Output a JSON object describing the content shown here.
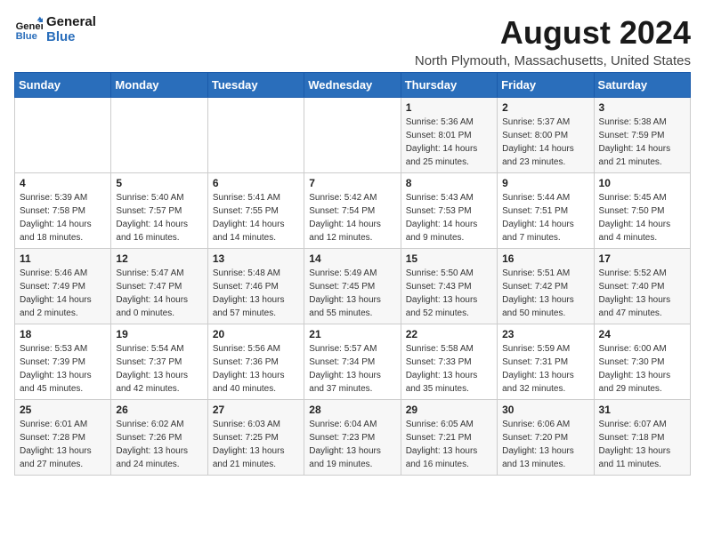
{
  "logo": {
    "line1": "General",
    "line2": "Blue"
  },
  "title": "August 2024",
  "subtitle": "North Plymouth, Massachusetts, United States",
  "weekdays": [
    "Sunday",
    "Monday",
    "Tuesday",
    "Wednesday",
    "Thursday",
    "Friday",
    "Saturday"
  ],
  "weeks": [
    [
      {
        "day": "",
        "info": ""
      },
      {
        "day": "",
        "info": ""
      },
      {
        "day": "",
        "info": ""
      },
      {
        "day": "",
        "info": ""
      },
      {
        "day": "1",
        "info": "Sunrise: 5:36 AM\nSunset: 8:01 PM\nDaylight: 14 hours\nand 25 minutes."
      },
      {
        "day": "2",
        "info": "Sunrise: 5:37 AM\nSunset: 8:00 PM\nDaylight: 14 hours\nand 23 minutes."
      },
      {
        "day": "3",
        "info": "Sunrise: 5:38 AM\nSunset: 7:59 PM\nDaylight: 14 hours\nand 21 minutes."
      }
    ],
    [
      {
        "day": "4",
        "info": "Sunrise: 5:39 AM\nSunset: 7:58 PM\nDaylight: 14 hours\nand 18 minutes."
      },
      {
        "day": "5",
        "info": "Sunrise: 5:40 AM\nSunset: 7:57 PM\nDaylight: 14 hours\nand 16 minutes."
      },
      {
        "day": "6",
        "info": "Sunrise: 5:41 AM\nSunset: 7:55 PM\nDaylight: 14 hours\nand 14 minutes."
      },
      {
        "day": "7",
        "info": "Sunrise: 5:42 AM\nSunset: 7:54 PM\nDaylight: 14 hours\nand 12 minutes."
      },
      {
        "day": "8",
        "info": "Sunrise: 5:43 AM\nSunset: 7:53 PM\nDaylight: 14 hours\nand 9 minutes."
      },
      {
        "day": "9",
        "info": "Sunrise: 5:44 AM\nSunset: 7:51 PM\nDaylight: 14 hours\nand 7 minutes."
      },
      {
        "day": "10",
        "info": "Sunrise: 5:45 AM\nSunset: 7:50 PM\nDaylight: 14 hours\nand 4 minutes."
      }
    ],
    [
      {
        "day": "11",
        "info": "Sunrise: 5:46 AM\nSunset: 7:49 PM\nDaylight: 14 hours\nand 2 minutes."
      },
      {
        "day": "12",
        "info": "Sunrise: 5:47 AM\nSunset: 7:47 PM\nDaylight: 14 hours\nand 0 minutes."
      },
      {
        "day": "13",
        "info": "Sunrise: 5:48 AM\nSunset: 7:46 PM\nDaylight: 13 hours\nand 57 minutes."
      },
      {
        "day": "14",
        "info": "Sunrise: 5:49 AM\nSunset: 7:45 PM\nDaylight: 13 hours\nand 55 minutes."
      },
      {
        "day": "15",
        "info": "Sunrise: 5:50 AM\nSunset: 7:43 PM\nDaylight: 13 hours\nand 52 minutes."
      },
      {
        "day": "16",
        "info": "Sunrise: 5:51 AM\nSunset: 7:42 PM\nDaylight: 13 hours\nand 50 minutes."
      },
      {
        "day": "17",
        "info": "Sunrise: 5:52 AM\nSunset: 7:40 PM\nDaylight: 13 hours\nand 47 minutes."
      }
    ],
    [
      {
        "day": "18",
        "info": "Sunrise: 5:53 AM\nSunset: 7:39 PM\nDaylight: 13 hours\nand 45 minutes."
      },
      {
        "day": "19",
        "info": "Sunrise: 5:54 AM\nSunset: 7:37 PM\nDaylight: 13 hours\nand 42 minutes."
      },
      {
        "day": "20",
        "info": "Sunrise: 5:56 AM\nSunset: 7:36 PM\nDaylight: 13 hours\nand 40 minutes."
      },
      {
        "day": "21",
        "info": "Sunrise: 5:57 AM\nSunset: 7:34 PM\nDaylight: 13 hours\nand 37 minutes."
      },
      {
        "day": "22",
        "info": "Sunrise: 5:58 AM\nSunset: 7:33 PM\nDaylight: 13 hours\nand 35 minutes."
      },
      {
        "day": "23",
        "info": "Sunrise: 5:59 AM\nSunset: 7:31 PM\nDaylight: 13 hours\nand 32 minutes."
      },
      {
        "day": "24",
        "info": "Sunrise: 6:00 AM\nSunset: 7:30 PM\nDaylight: 13 hours\nand 29 minutes."
      }
    ],
    [
      {
        "day": "25",
        "info": "Sunrise: 6:01 AM\nSunset: 7:28 PM\nDaylight: 13 hours\nand 27 minutes."
      },
      {
        "day": "26",
        "info": "Sunrise: 6:02 AM\nSunset: 7:26 PM\nDaylight: 13 hours\nand 24 minutes."
      },
      {
        "day": "27",
        "info": "Sunrise: 6:03 AM\nSunset: 7:25 PM\nDaylight: 13 hours\nand 21 minutes."
      },
      {
        "day": "28",
        "info": "Sunrise: 6:04 AM\nSunset: 7:23 PM\nDaylight: 13 hours\nand 19 minutes."
      },
      {
        "day": "29",
        "info": "Sunrise: 6:05 AM\nSunset: 7:21 PM\nDaylight: 13 hours\nand 16 minutes."
      },
      {
        "day": "30",
        "info": "Sunrise: 6:06 AM\nSunset: 7:20 PM\nDaylight: 13 hours\nand 13 minutes."
      },
      {
        "day": "31",
        "info": "Sunrise: 6:07 AM\nSunset: 7:18 PM\nDaylight: 13 hours\nand 11 minutes."
      }
    ]
  ]
}
